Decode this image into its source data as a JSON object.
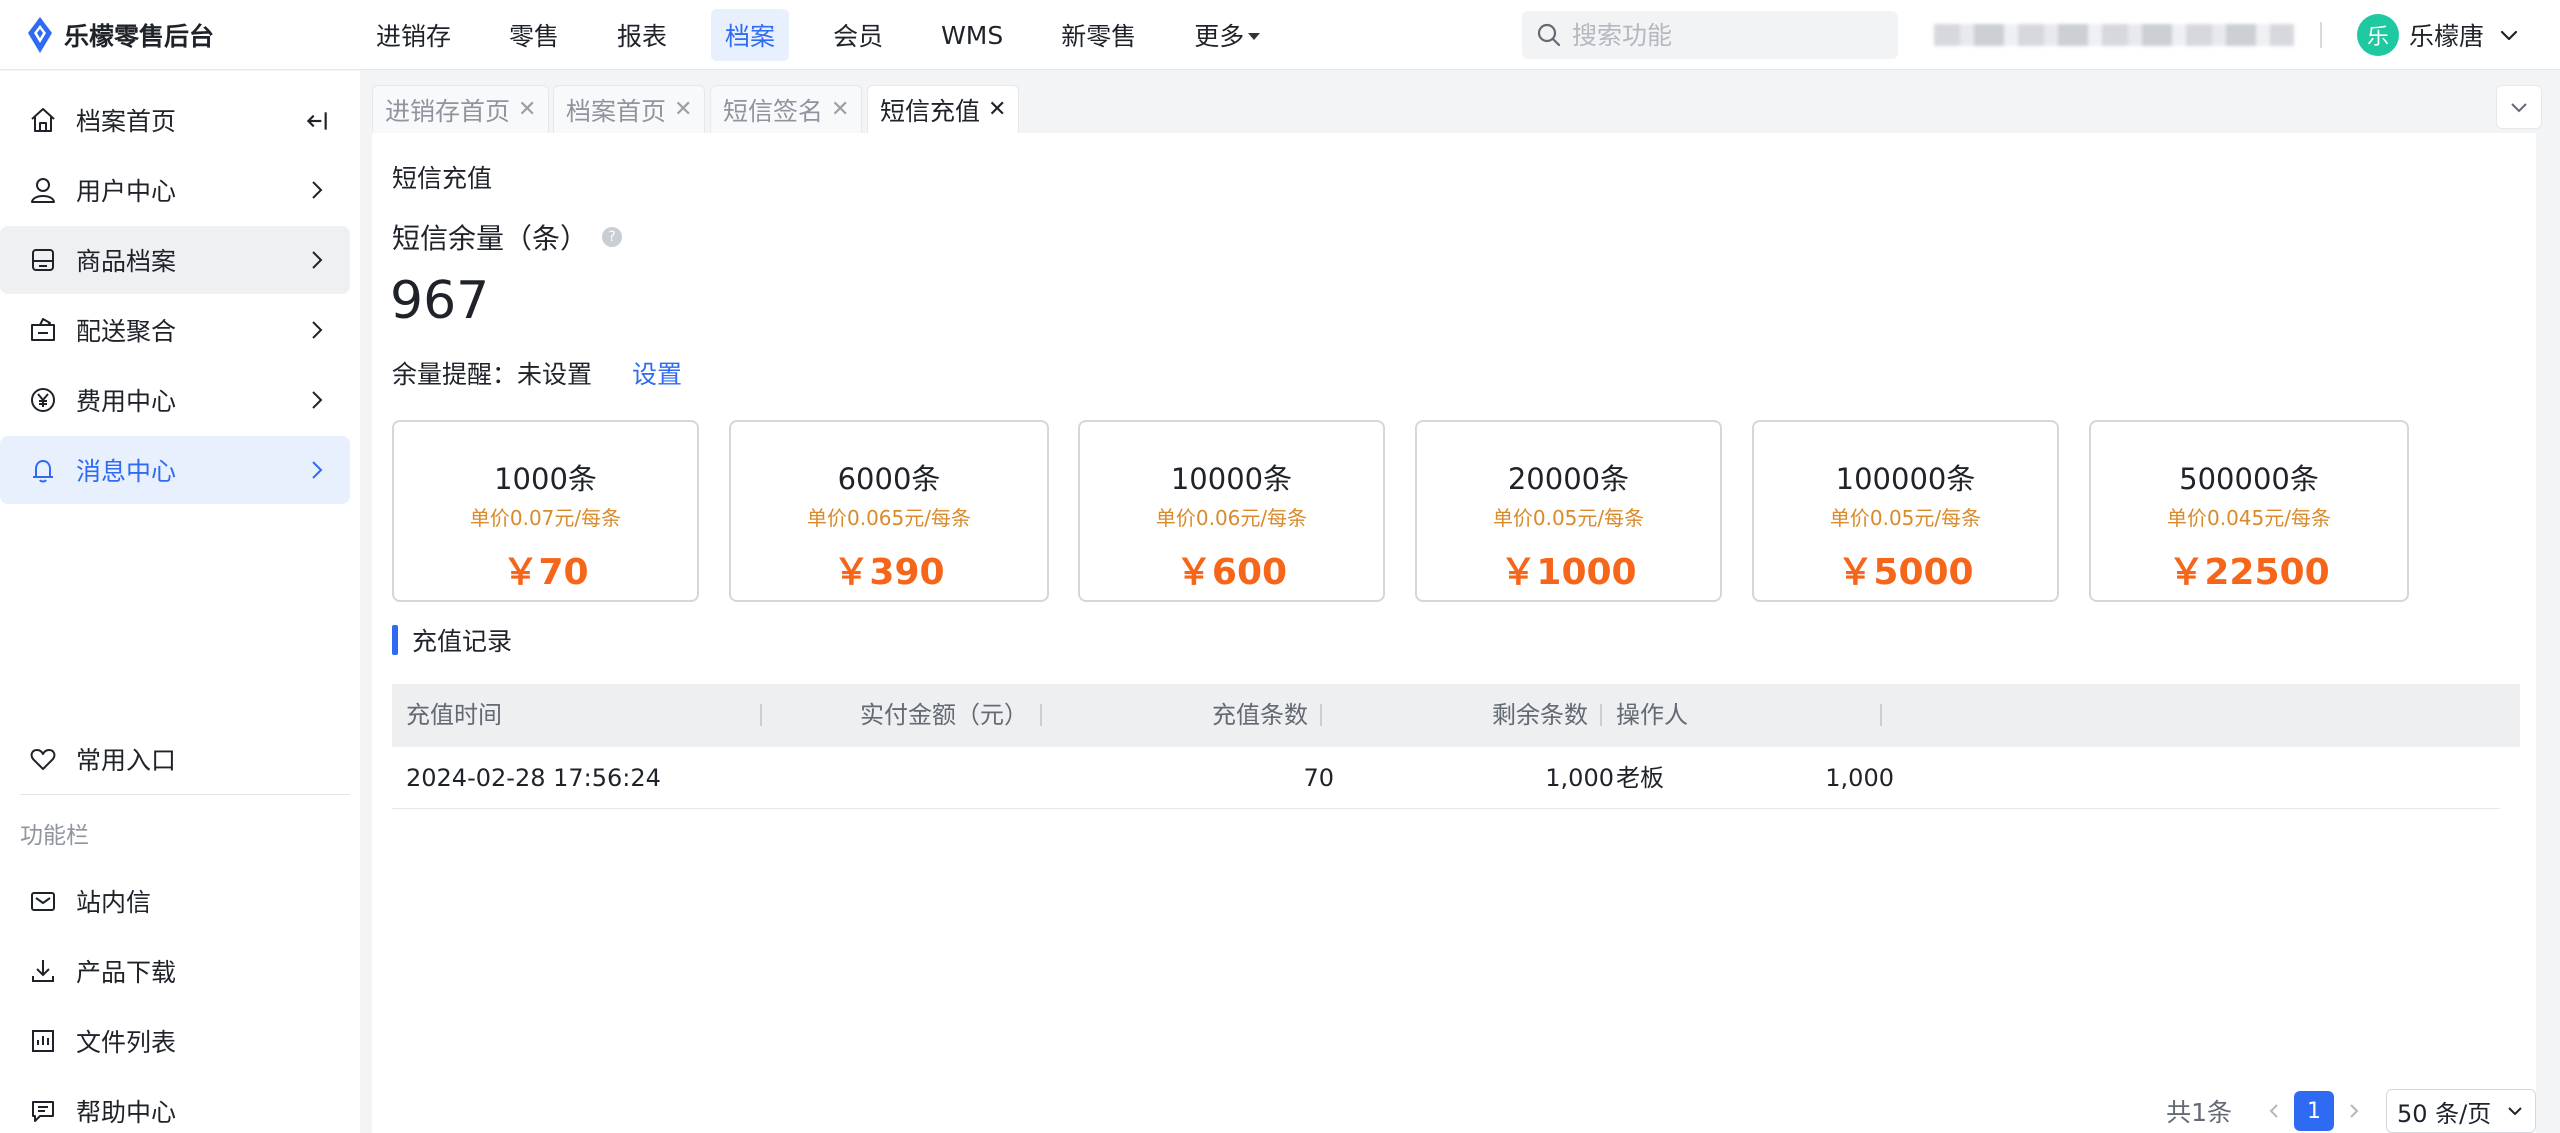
{
  "app": {
    "title": "乐檬零售后台"
  },
  "topnav": {
    "items": [
      {
        "label": "进销存",
        "active": false
      },
      {
        "label": "零售",
        "active": false
      },
      {
        "label": "报表",
        "active": false
      },
      {
        "label": "档案",
        "active": true
      },
      {
        "label": "会员",
        "active": false
      },
      {
        "label": "WMS",
        "active": false
      },
      {
        "label": "新零售",
        "active": false
      },
      {
        "label": "更多",
        "active": false,
        "dropdown": true
      }
    ],
    "search_placeholder": "搜索功能"
  },
  "user": {
    "avatar_text": "乐",
    "name": "乐檬唐"
  },
  "sidebar": {
    "items": [
      {
        "label": "档案首页",
        "icon": "home-icon"
      },
      {
        "label": "用户中心",
        "icon": "user-icon"
      },
      {
        "label": "商品档案",
        "icon": "box-icon"
      },
      {
        "label": "配送聚合",
        "icon": "delivery-icon"
      },
      {
        "label": "费用中心",
        "icon": "yen-icon"
      },
      {
        "label": "消息中心",
        "icon": "bell-icon"
      }
    ],
    "favorites_label": "常用入口",
    "section_label": "功能栏",
    "tools": [
      {
        "label": "站内信",
        "icon": "mail-icon"
      },
      {
        "label": "产品下载",
        "icon": "download-icon"
      },
      {
        "label": "文件列表",
        "icon": "file-list-icon"
      },
      {
        "label": "帮助中心",
        "icon": "help-chat-icon"
      }
    ]
  },
  "tabs": [
    {
      "label": "进销存首页",
      "active": false
    },
    {
      "label": "档案首页",
      "active": false
    },
    {
      "label": "短信签名",
      "active": false
    },
    {
      "label": "短信充值",
      "active": true
    }
  ],
  "main": {
    "page_title": "短信充值",
    "balance_label": "短信余量（条）",
    "balance_value": "967",
    "reminder_label": "余量提醒：",
    "reminder_value": "未设置",
    "reminder_link": "设置",
    "packages": [
      {
        "count": "1000条",
        "unit_price": "单价0.07元/每条",
        "price": "￥70"
      },
      {
        "count": "6000条",
        "unit_price": "单价0.065元/每条",
        "price": "￥390"
      },
      {
        "count": "10000条",
        "unit_price": "单价0.06元/每条",
        "price": "￥600"
      },
      {
        "count": "20000条",
        "unit_price": "单价0.05元/每条",
        "price": "￥1000"
      },
      {
        "count": "100000条",
        "unit_price": "单价0.05元/每条",
        "price": "￥5000"
      },
      {
        "count": "500000条",
        "unit_price": "单价0.045元/每条",
        "price": "￥22500"
      }
    ],
    "records_title": "充值记录",
    "table": {
      "columns": [
        "充值时间",
        "实付金额（元）",
        "充值条数",
        "剩余条数",
        "操作人"
      ],
      "rows": [
        [
          "2024-02-28 17:56:24",
          "70",
          "1,000",
          "1,000",
          "老板"
        ]
      ]
    },
    "pagination": {
      "total": "共1条",
      "current_page": "1",
      "page_size": "50 条/页"
    }
  },
  "colors": {
    "accent": "#2f6bf2",
    "price": "#f5661a",
    "unit_price": "#d98a2b",
    "avatar": "#1ec8a0"
  }
}
